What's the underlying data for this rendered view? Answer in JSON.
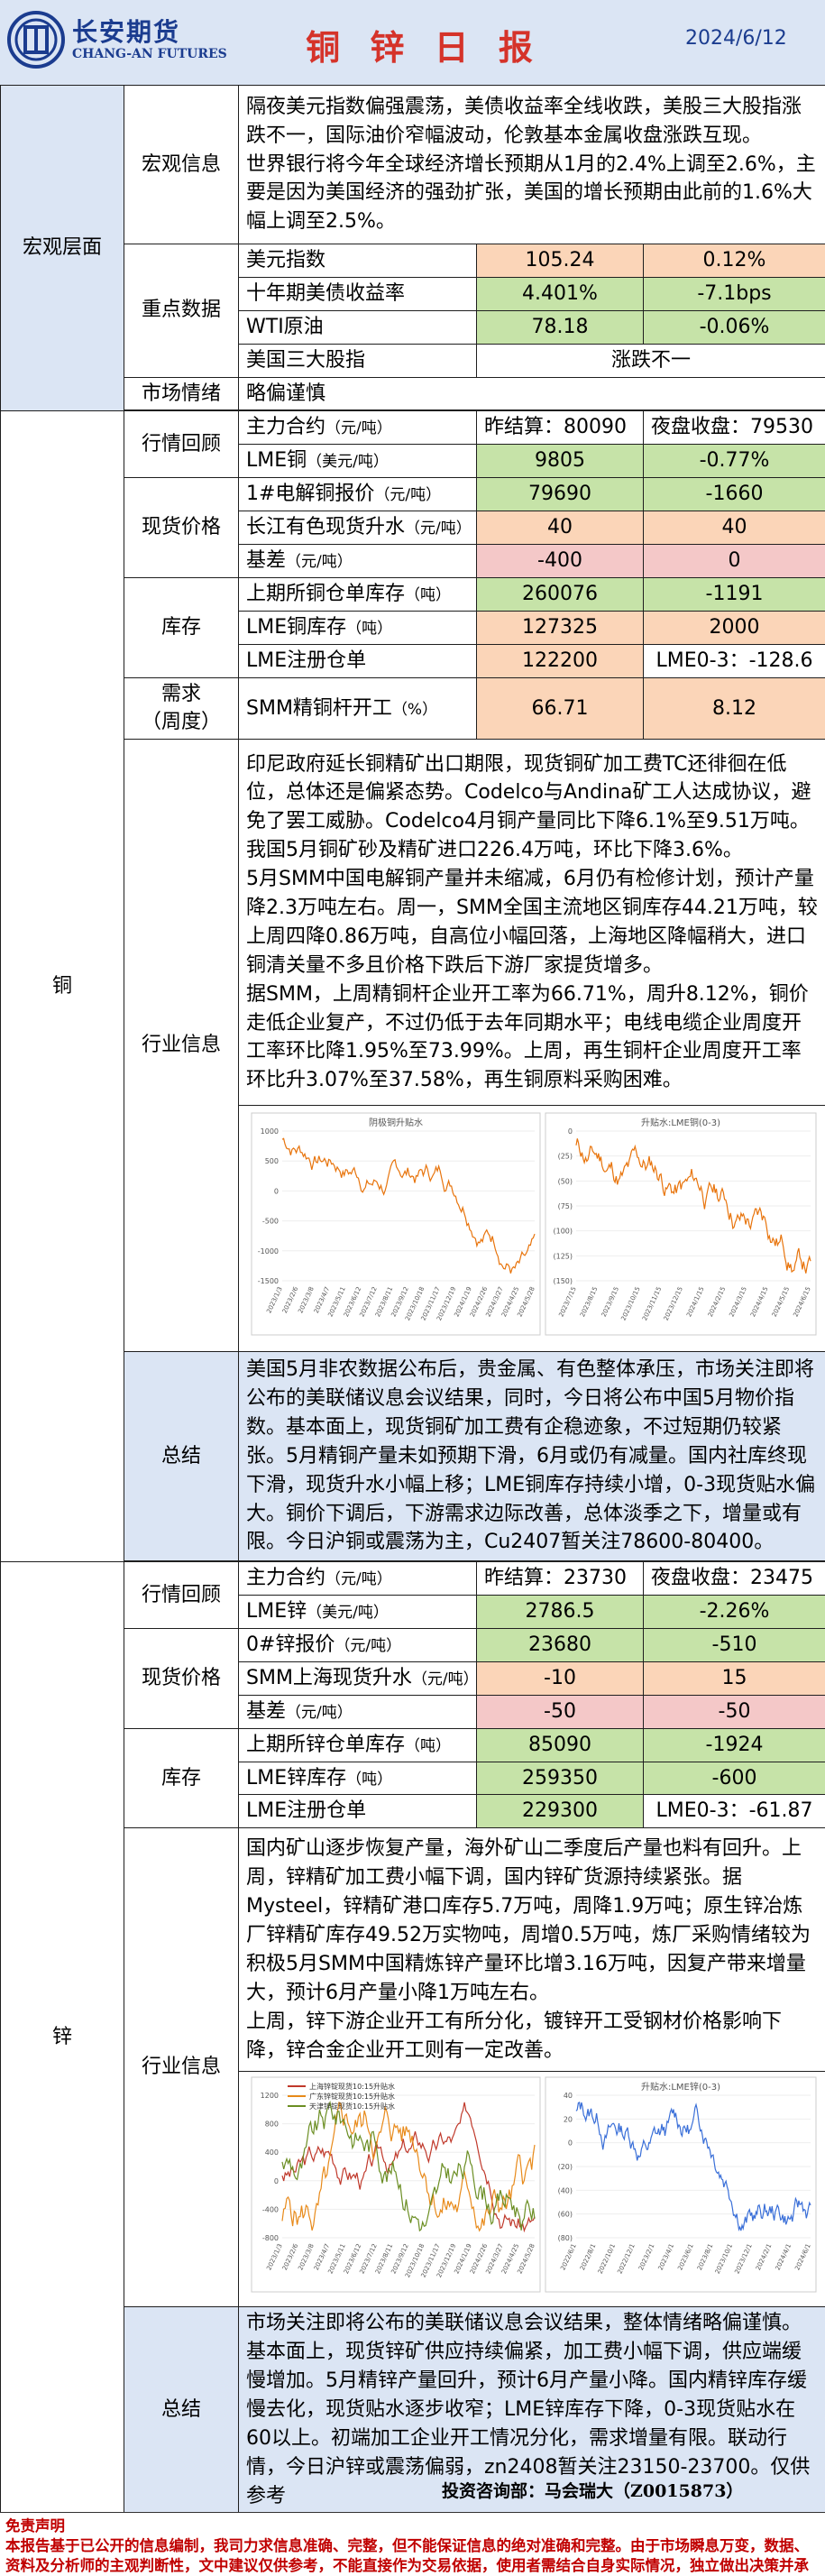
{
  "header": {
    "company_cn": "长安期货",
    "company_en": "CHANG-AN FUTURES",
    "title": "铜 锌 日 报",
    "date": "2024/6/12"
  },
  "macro": {
    "section": "宏观层面",
    "info_label": "宏观信息",
    "info_text_1": "隔夜美元指数偏强震荡，美债收益率全线收跌，美股三大股指涨跌不一，国际油价窄幅波动，伦敦基本金属收盘涨跌互现。",
    "info_text_2": "世界银行将今年全球经济增长预期从1月的2.4%上调至2.6%，主要是因为美国经济的强劲扩张，美国的增长预期由此前的1.6%大幅上调至2.5%。",
    "key_label": "重点数据",
    "rows": [
      {
        "name": "美元指数",
        "v1": "105.24",
        "v2": "0.12%"
      },
      {
        "name": "十年期美债收益率",
        "v1": "4.401%",
        "v2": "-7.1bps"
      },
      {
        "name": "WTI原油",
        "v1": "78.18",
        "v2": "-0.06%"
      },
      {
        "name": "美国三大股指",
        "v1": "涨跌不一"
      }
    ],
    "mood_label": "市场情绪",
    "mood": "略偏谨慎"
  },
  "copper": {
    "section": "铜",
    "quote_label": "行情回顾",
    "main_contract": "主力合约",
    "unit_yuan_t": "（元/吨）",
    "settle": "昨结算：80090",
    "night": "夜盘收盘：79530",
    "lme_name": "LME铜",
    "unit_usd_t": "（美元/吨）",
    "lme_val": "9805",
    "lme_chg": "-0.77%",
    "spot_label": "现货价格",
    "spot_name": "1#电解铜报价",
    "spot_val": "79690",
    "spot_chg": "-1660",
    "cj_name": "长江有色现货升水",
    "cj_val": "40",
    "cj_chg": "40",
    "basis_name": "基差",
    "basis_val": "-400",
    "basis_chg": "0",
    "stock_label": "库存",
    "shfe_name": "上期所铜仓单库存",
    "unit_t": "（吨）",
    "shfe_val": "260076",
    "shfe_chg": "-1191",
    "lmes_name": "LME铜库存",
    "lmes_val": "127325",
    "lmes_chg": "2000",
    "reg_name": "LME注册仓单",
    "reg_val": "122200",
    "reg_chg": "LME0-3：-128.6",
    "demand_label": "需求\n（周度）",
    "smm_name": "SMM精铜杆开工",
    "unit_pct": "（%）",
    "smm_val": "66.71",
    "smm_chg": "8.12",
    "industry_label": "行业信息",
    "industry_text": "印尼政府延长铜精矿出口期限，现货铜矿加工费TC还徘徊在低位，总体还是偏紧态势。Codelco与Andina矿工人达成协议，避免了罢工威胁。Codelco4月铜产量同比下降6.1%至9.51万吨。我国5月铜矿砂及精矿进口226.4万吨，环比下降3.6%。\n5月SMM中国电解铜产量并未缩减，6月仍有检修计划，预计产量降2.3万吨左右。周一，SMM全国主流地区铜库存44.21万吨，较上周四降0.86万吨，自高位小幅回落，上海地区降幅稍大，进口铜清关量不多且价格下跌后下游厂家提货增多。\n据SMM，上周精铜杆企业开工率为66.71%，周升8.12%，铜价走低企业复产，不过仍低于去年同期水平；电线电缆企业周度开工率环比降1.95%至73.99%。上周，再生铜杆企业周度开工率环比升3.07%至37.58%，再生铜原料采购困难。",
    "chart1_title": "阴极铜升贴水",
    "chart1_yticks": [
      "1000",
      "500",
      "0",
      "-500",
      "-1000",
      "-1500"
    ],
    "chart1_xticks": [
      "2023/1/3",
      "2023/2/6",
      "2023/3/8",
      "2023/4/7",
      "2023/5/11",
      "2023/6/12",
      "2023/7/12",
      "2023/8/11",
      "2023/9/12",
      "2023/10/18",
      "2023/11/17",
      "2023/12/19",
      "2024/1/19",
      "2024/2/26",
      "2024/3/27",
      "2024/4/25",
      "2024/5/28"
    ],
    "chart2_title": "升贴水:LME铜(0-3)",
    "chart2_yticks": [
      "0",
      "(25)",
      "(50)",
      "(75)",
      "(100)",
      "(125)",
      "(150)"
    ],
    "chart2_xticks": [
      "2023/7/15",
      "2023/8/15",
      "2023/9/15",
      "2023/10/15",
      "2023/11/15",
      "2023/12/15",
      "2024/1/15",
      "2024/2/15",
      "2024/3/15",
      "2024/4/15",
      "2024/5/15",
      "2024/6/15"
    ],
    "summary_label": "总结",
    "summary_text": "美国5月非农数据公布后，贵金属、有色整体承压，市场关注即将公布的美联储议息会议结果，同时，今日将公布中国5月物价指数。基本面上，现货铜矿加工费有企稳迹象，不过短期仍较紧张。5月精铜产量未如预期下滑，6月或仍有减量。国内社库终现下滑，现货升水小幅上移；LME铜库存持续小增，0-3现货贴水偏大。铜价下调后，下游需求边际改善，总体淡季之下，增量或有限。今日沪铜或震荡为主，Cu2407暂关注78600-80400。"
  },
  "zinc": {
    "section": "锌",
    "quote_label": "行情回顾",
    "main_contract": "主力合约",
    "unit_yuan_t": "（元/吨）",
    "settle": "昨结算：23730",
    "night": "夜盘收盘：23475",
    "lme_name": "LME锌",
    "unit_usd_t": "（美元/吨）",
    "lme_val": "2786.5",
    "lme_chg": "-2.26%",
    "spot_label": "现货价格",
    "spot_name": "0#锌报价",
    "spot_val": "23680",
    "spot_chg": "-510",
    "sh_name": "SMM上海现货升水",
    "unit_yuan_t2": "（元/吨）",
    "sh_val": "-10",
    "sh_chg": "15",
    "basis_name": "基差",
    "basis_val": "-50",
    "basis_chg": "-50",
    "stock_label": "库存",
    "shfe_name": "上期所锌仓单库存",
    "unit_t": "（吨）",
    "shfe_val": "85090",
    "shfe_chg": "-1924",
    "lmes_name": "LME锌库存",
    "lmes_val": "259350",
    "lmes_chg": "-600",
    "reg_name": "LME注册仓单",
    "reg_val": "229300",
    "reg_chg": "LME0-3：-61.87",
    "industry_label": "行业信息",
    "industry_text": "国内矿山逐步恢复产量，海外矿山二季度后产量也料有回升。上周，锌精矿加工费小幅下调，国内锌矿货源持续紧张。据Mysteel，锌精矿港口库存5.7万吨，周降1.9万吨；原生锌冶炼厂锌精矿库存49.52万实物吨，周增0.5万吨，炼厂采购情绪较为积极5月SMM中国精炼锌产量环比增3.16万吨，因复产带来增量大，预计6月产量小降1万吨左右。\n上周，锌下游企业开工有所分化，镀锌开工受钢材价格影响下降，锌合金企业开工则有一定改善。",
    "chart1_legend": [
      "上海锌锭现货10:15升贴水",
      "广东锌锭现货10:15升贴水",
      "天津锌锭现货10:15升贴水"
    ],
    "chart1_yticks": [
      "1200",
      "800",
      "400",
      "0",
      "-400",
      "-800"
    ],
    "chart1_xticks": [
      "2023/1/3",
      "2023/2/6",
      "2023/3/8",
      "2023/4/7",
      "2023/5/11",
      "2023/6/12",
      "2023/7/12",
      "2023/8/11",
      "2023/9/12",
      "2023/10/18",
      "2023/11/17",
      "2023/12/19",
      "2024/1/19",
      "2024/2/26",
      "2024/3/27",
      "2024/4/25",
      "2024/5/28"
    ],
    "chart2_title": "升贴水:LME锌(0-3)",
    "chart2_yticks": [
      "40",
      "20",
      "0",
      "(20)",
      "(40)",
      "(60)",
      "(80)"
    ],
    "chart2_xticks": [
      "2022/6/1",
      "2022/8/1",
      "2022/10/1",
      "2022/12/1",
      "2023/2/1",
      "2023/4/1",
      "2023/6/1",
      "2023/8/1",
      "2023/10/1",
      "2023/12/1",
      "2024/2/1",
      "2024/4/1",
      "2024/6/1"
    ],
    "summary_label": "总结",
    "summary_text": "市场关注即将公布的美联储议息会议结果，整体情绪略偏谨慎。基本面上，现货锌矿供应持续偏紧，加工费小幅下调，供应端缓慢增加。5月精锌产量回升，预计6月产量小降。国内精锌库存缓慢去化，现货贴水逐步收窄；LME锌库存下降，0-3现货贴水在60以上。初端加工企业开工情况分化，需求增量有限。联动行情，今日沪锌或震荡偏弱，zn2408暂关注23150-23700。仅供参考"
  },
  "footer": {
    "consult": "投资咨询部：马会瑞大（Z0015873）",
    "disc_title": "免责声明",
    "disc_text": "本报告基于已公开的信息编制，我司力求信息准确、完整，但不能保证信息的绝对准确和完整。由于市场瞬息万变，数据、资料及分析师的主观判断性，文中建议仅供参考，不能直接作为交易依据，使用者需结合自身实际情况，独立做出决策并承担相应后果；凡据本报告入市者，本公司及作者均不承担任何法律责任。"
  },
  "colors": {
    "header_bg": "#dbe5f4",
    "title_red": "#d5332a",
    "brand_blue": "#1b3c8f",
    "orange": "#fbd5b8",
    "green": "#c6e3a8",
    "pink": "#f4c8c8",
    "line_orange": "#e8740c",
    "disclaimer_red": "#c00000"
  }
}
